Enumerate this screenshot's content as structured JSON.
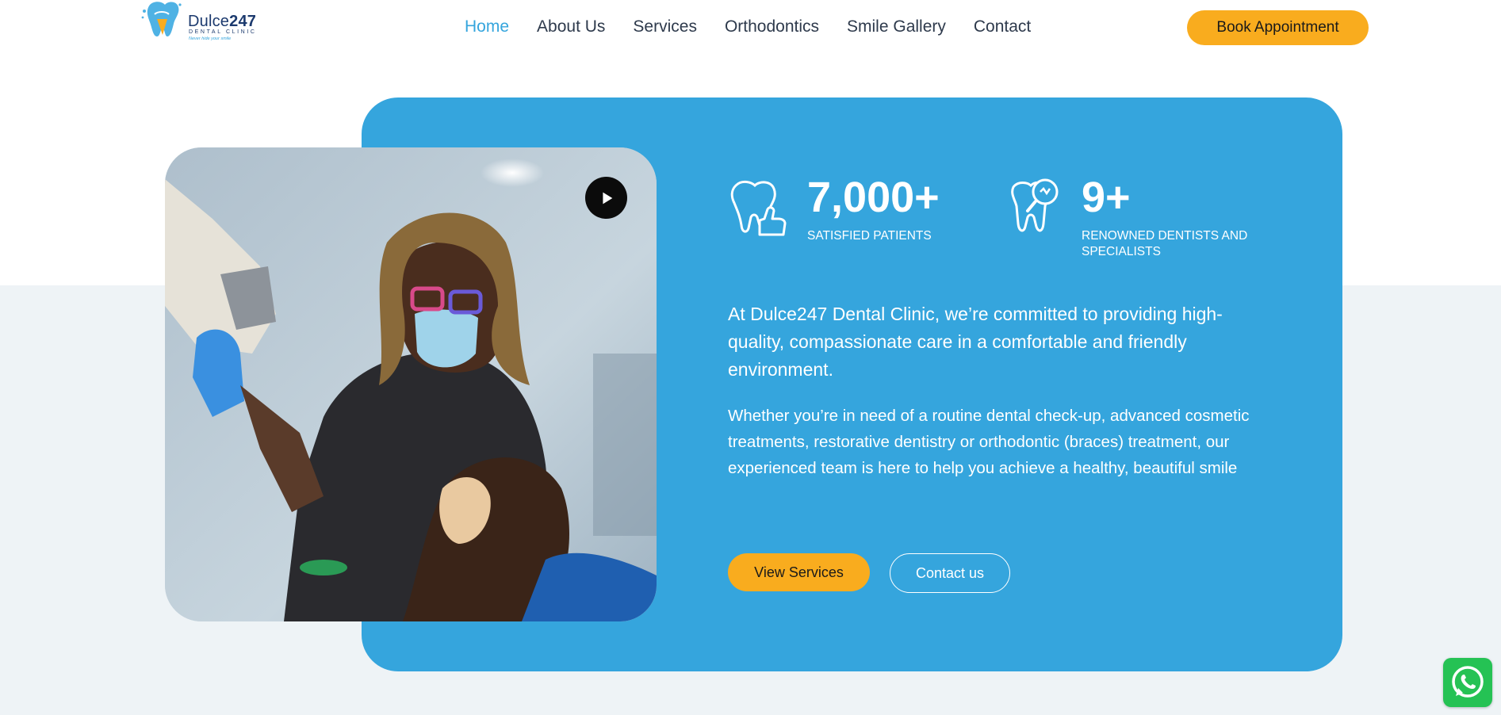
{
  "header": {
    "logo": {
      "name_regular": "Dulce",
      "name_bold": "247",
      "subtitle": "DENTAL CLINIC",
      "tagline": "Never hide your smile"
    },
    "nav": [
      {
        "label": "Home",
        "active": true
      },
      {
        "label": "About Us",
        "active": false
      },
      {
        "label": "Services",
        "active": false
      },
      {
        "label": "Orthodontics",
        "active": false
      },
      {
        "label": "Smile Gallery",
        "active": false
      },
      {
        "label": "Contact",
        "active": false
      }
    ],
    "cta_label": "Book Appointment"
  },
  "hero": {
    "stats": [
      {
        "value": "7,000+",
        "label": "SATISFIED PATIENTS",
        "icon": "tooth-thumbs-up-icon"
      },
      {
        "value": "9+",
        "label": "RENOWNED DENTISTS AND SPECIALISTS",
        "icon": "tooth-magnifier-icon"
      }
    ],
    "lead": "At Dulce247 Dental Clinic, we’re committed to providing high-quality, compassionate care in a comfortable and friendly environment.",
    "body": "Whether you’re in need of a routine dental check-up, advanced cosmetic treatments, restorative dentistry or orthodontic (braces) treatment, our experienced team is here to help you achieve a healthy, beautiful smile",
    "primary_button": "View Services",
    "secondary_button": "Contact us"
  },
  "colors": {
    "accent_blue": "#35a5dd",
    "accent_orange": "#f9ac1e",
    "nav_text": "#2e3a4c",
    "lower_background": "#eef3f6",
    "whatsapp_green": "#25c254"
  },
  "floating": {
    "whatsapp_icon": "whatsapp-icon"
  }
}
